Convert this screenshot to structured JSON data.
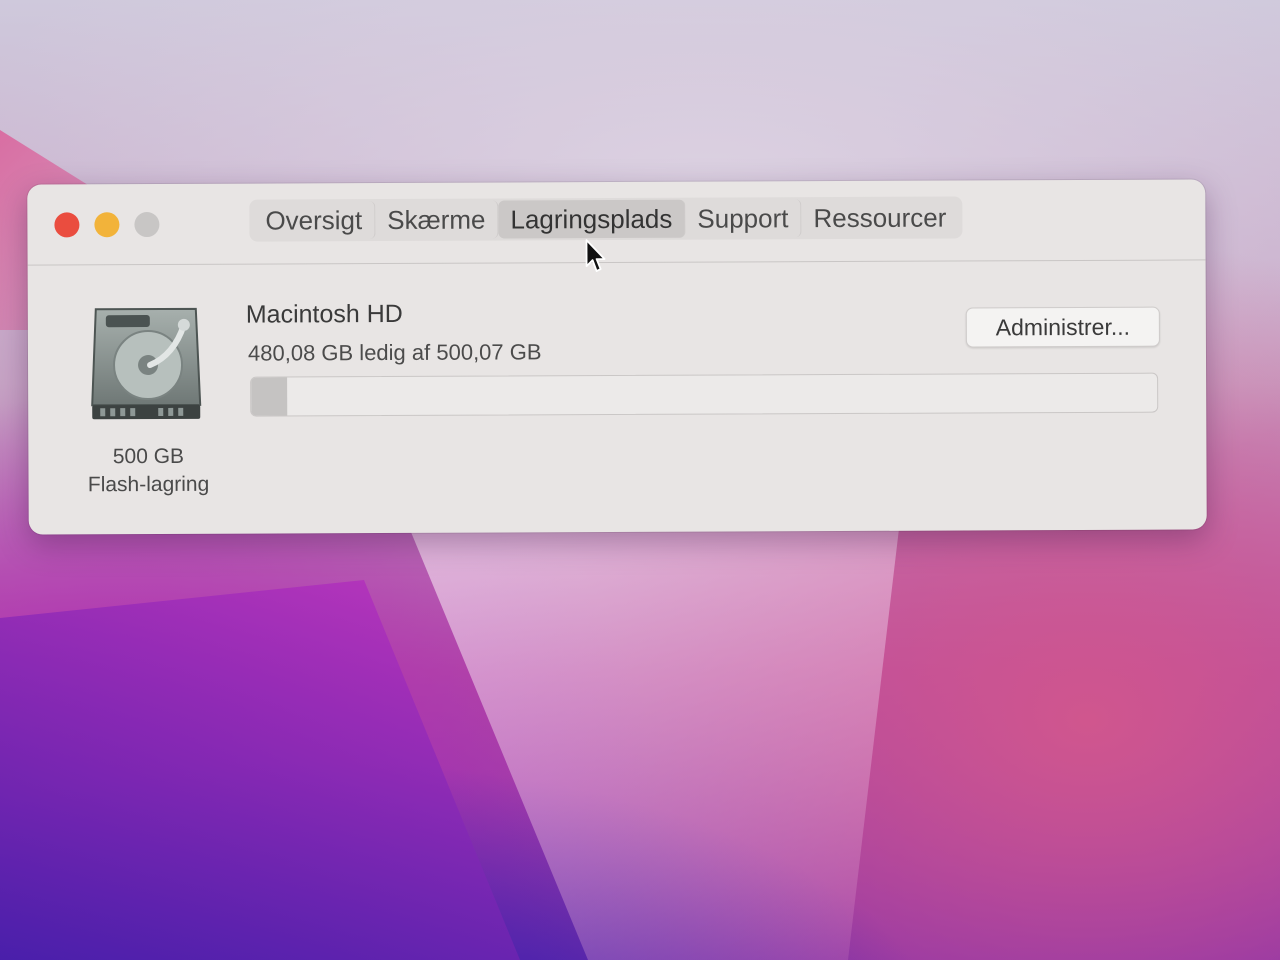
{
  "window": {
    "tabs": [
      {
        "label": "Oversigt",
        "active": false
      },
      {
        "label": "Skærme",
        "active": false
      },
      {
        "label": "Lagringsplads",
        "active": true
      },
      {
        "label": "Support",
        "active": false
      },
      {
        "label": "Ressourcer",
        "active": false
      }
    ]
  },
  "storage": {
    "disk_size_label": "500 GB",
    "disk_type_label": "Flash-lagring",
    "volume_name": "Macintosh HD",
    "free_text": "480,08 GB ledig af 500,07 GB",
    "manage_button_label": "Administrer...",
    "used_fraction": 0.04
  },
  "icons": {
    "disk": "hard-drive-icon",
    "cursor": "arrow-cursor-icon"
  },
  "colors": {
    "close": "#ea4d3f",
    "minimize": "#f2b33a",
    "zoom_disabled": "#c8c6c5"
  }
}
